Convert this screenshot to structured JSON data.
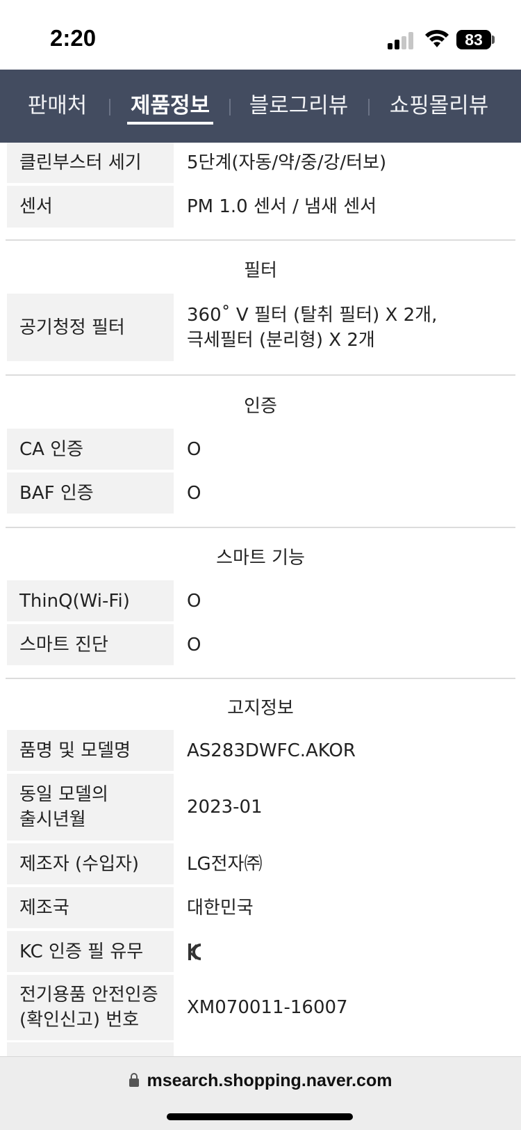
{
  "status": {
    "time": "2:20",
    "battery": "83"
  },
  "tabs": [
    {
      "label": "판매처"
    },
    {
      "label": "제품정보",
      "active": true
    },
    {
      "label": "블로그리뷰"
    },
    {
      "label": "쇼핑몰리뷰"
    }
  ],
  "specs_top": [
    {
      "label": "클린부스터 세기",
      "value": "5단계(자동/약/중/강/터보)"
    },
    {
      "label": "센서",
      "value": "PM 1.0 센서 / 냄새 센서"
    }
  ],
  "section_filter": {
    "title": "필터",
    "rows": [
      {
        "label": "공기청정 필터",
        "value_line1": "360˚ V 필터 (탈취 필터) X 2개,",
        "value_line2": "극세필터 (분리형) X 2개"
      }
    ]
  },
  "section_cert": {
    "title": "인증",
    "rows": [
      {
        "label": "CA 인증",
        "value": "O"
      },
      {
        "label": "BAF 인증",
        "value": "O"
      }
    ]
  },
  "section_smart": {
    "title": "스마트 기능",
    "rows": [
      {
        "label": "ThinQ(Wi-Fi)",
        "value": "O"
      },
      {
        "label": "스마트 진단",
        "value": "O"
      }
    ]
  },
  "section_notice": {
    "title": "고지정보",
    "rows": [
      {
        "label": "품명 및 모델명",
        "value": "AS283DWFC.AKOR"
      },
      {
        "label_line1": "동일 모델의",
        "label_line2": "출시년월",
        "value": "2023-01"
      },
      {
        "label": "제조자 (수입자)",
        "value": "LG전자㈜"
      },
      {
        "label": "제조국",
        "value": "대한민국"
      },
      {
        "label": "KC 인증 필 유무",
        "value_icon": "kc-mark-icon"
      },
      {
        "label_line1": "전기용품 안전인증",
        "label_line2": "(확인신고) 번호",
        "value": "XM070011-16007"
      }
    ]
  },
  "url": {
    "text": "msearch.shopping.naver.com"
  }
}
